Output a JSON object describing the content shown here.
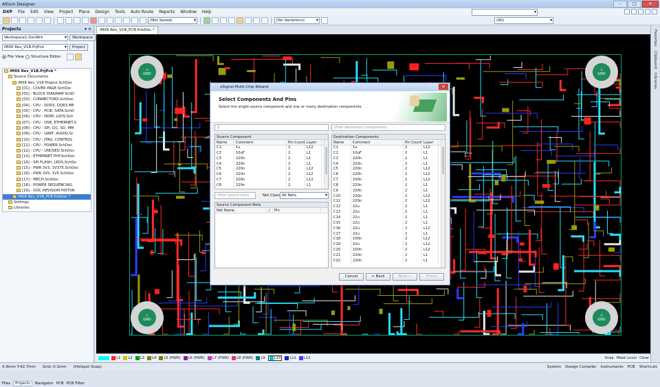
{
  "app": {
    "title": "Altium Designer",
    "dxp": "DXP"
  },
  "menu": [
    "File",
    "Edit",
    "View",
    "Project",
    "Place",
    "Design",
    "Tools",
    "Auto Route",
    "Reports",
    "Window",
    "Help"
  ],
  "toolbar": {
    "saved_combo": "(Not Saved)",
    "variations_combo": "[No Variations]",
    "filter_combo": "(All)"
  },
  "projects_panel": {
    "title": "Projects",
    "workspace_value": "Workspace1.DsnWrk",
    "workspace_button": "Workspace",
    "project_value": "iMX6 Rev_V1B.PrjPcb",
    "project_button": "Project",
    "file_view": "File View",
    "structure_editor": "Structure Editor",
    "tree": [
      {
        "label": "iMX6 Rev_V1B.PrjPcb *",
        "indent": 0,
        "bold": true
      },
      {
        "label": "Source Documents",
        "indent": 1
      },
      {
        "label": "iMX6 Rev_V1B Project.SchDoc",
        "indent": 2
      },
      {
        "label": "[01] - COVER PAGE.SchDoc",
        "indent": 3
      },
      {
        "label": "[02] - BLOCK DIAGRAM.SchD",
        "indent": 3
      },
      {
        "label": "[03] - CONNECTORS.SchDoc",
        "indent": 3
      },
      {
        "label": "[04] - CPU - DDR3, DDR3 ME",
        "indent": 3
      },
      {
        "label": "[05] - CPU - PCIE, SATA.SchD",
        "indent": 3
      },
      {
        "label": "[06] - CPU - HDMI, LVDS.Sch",
        "indent": 3
      },
      {
        "label": "[07] - CPU - USB, ETHERNET.S",
        "indent": 3
      },
      {
        "label": "[08] - CPU - SPI, I2C, SD, MM",
        "indent": 3
      },
      {
        "label": "[09] - CPU - UART, AUDIO.Sc",
        "indent": 3
      },
      {
        "label": "[10] - CPU - JTAG, CONTROL",
        "indent": 3
      },
      {
        "label": "[11] - CPU - POWER.SchDoc",
        "indent": 3
      },
      {
        "label": "[12] - CPU - UNUSED.SchDoc",
        "indent": 3
      },
      {
        "label": "[13] - ETHERNET PHY.SchDoc",
        "indent": 3
      },
      {
        "label": "[14] - SPI FLASH, LEDS.SchDo",
        "indent": 3
      },
      {
        "label": "[15] - PWR 3V3, 1V375.SchDoc",
        "indent": 3
      },
      {
        "label": "[16] - PWR 2V5, 1V5.SchDoc",
        "indent": 3
      },
      {
        "label": "[17] - MECH.SchDoc",
        "indent": 3
      },
      {
        "label": "[18] - POWER SEQUENCING.",
        "indent": 3
      },
      {
        "label": "[19] - DOC REVISION HISTOR",
        "indent": 3
      },
      {
        "label": "iMX6 Rev_V1B_PCB.PcbDoc *",
        "indent": 2,
        "selected": true
      },
      {
        "label": "Settings",
        "indent": 1
      },
      {
        "label": "Libraries",
        "indent": 1
      }
    ],
    "tabs": [
      "Files",
      "Projects",
      "Navigator",
      "PCB",
      "PCB Filter"
    ]
  },
  "document_tab": "iMX6 Rev_V1B_PCB.PcbDoc *",
  "right_panels": [
    "Favorites",
    "Clipboard",
    "Libraries"
  ],
  "board": {
    "hole_label_top": "GND",
    "hole_label": "GND"
  },
  "wizard": {
    "title": "xSignal Multi-Chip Wizard",
    "heading": "Select Components And Pins",
    "subheading": "Select the single source component and one or many destination components",
    "filter_dest_placeholder": "(filter destination components)",
    "filter_nets_placeholder": "(filter source nets)",
    "net_class_label": "Net Class:",
    "net_class_value": "All Nets",
    "source": {
      "caption": "Source Component",
      "headers": [
        "Name",
        "Comment",
        "Pin Count",
        "Layer"
      ],
      "rows": [
        [
          "C1",
          "1u",
          "2",
          "L12"
        ],
        [
          "C2",
          "10uF",
          "2",
          "L1"
        ],
        [
          "C3",
          "220n",
          "2",
          "L1"
        ],
        [
          "C4",
          "220n",
          "2",
          "L1"
        ],
        [
          "C5",
          "220n",
          "2",
          "L12"
        ],
        [
          "C6",
          "220n",
          "2",
          "L12"
        ],
        [
          "C7",
          "100n",
          "2",
          "L12"
        ],
        [
          "C8",
          "220n",
          "2",
          "L1"
        ]
      ]
    },
    "nets": {
      "caption": "Source Component Nets",
      "headers": [
        "Net Name",
        "/",
        "Pin"
      ]
    },
    "dest": {
      "caption": "Destination Components",
      "headers": [
        "Name",
        "Comment",
        "Pin Count",
        "Layer"
      ],
      "rows": [
        [
          "C1",
          "1u",
          "2",
          "L12"
        ],
        [
          "C2",
          "10uF",
          "2",
          "L1"
        ],
        [
          "C3",
          "220n",
          "2",
          "L1"
        ],
        [
          "C4",
          "220n",
          "2",
          "L1"
        ],
        [
          "C5",
          "220n",
          "2",
          "L12"
        ],
        [
          "C6",
          "220n",
          "2",
          "L12"
        ],
        [
          "C7",
          "100n",
          "2",
          "L12"
        ],
        [
          "C8",
          "220n",
          "2",
          "L1"
        ],
        [
          "C9",
          "220n",
          "2",
          "L1"
        ],
        [
          "C10",
          "220n",
          "2",
          "L12"
        ],
        [
          "C11",
          "220n",
          "2",
          "L12"
        ],
        [
          "C12",
          "22u",
          "2",
          "L1"
        ],
        [
          "C13",
          "22u",
          "2",
          "L1"
        ],
        [
          "C14",
          "22u",
          "2",
          "L1"
        ],
        [
          "C15",
          "22u",
          "2",
          "L1"
        ],
        [
          "C16",
          "22u",
          "2",
          "L12"
        ],
        [
          "C17",
          "22u",
          "2",
          "L1"
        ],
        [
          "C18",
          "100n",
          "2",
          "L12"
        ],
        [
          "C19",
          "10u",
          "2",
          "L12"
        ],
        [
          "C20",
          "100n",
          "2",
          "L12"
        ],
        [
          "C21",
          "220n",
          "2",
          "L1"
        ],
        [
          "C22",
          "220n",
          "2",
          "L1"
        ]
      ]
    },
    "buttons": {
      "cancel": "Cancel",
      "back": "< Back",
      "next": "Next >",
      "finish": "Finish"
    }
  },
  "layers": [
    {
      "label": "L1",
      "color": "#ff2020"
    },
    {
      "label": "L2",
      "color": "#c8c800"
    },
    {
      "label": "L3",
      "color": "#00a000"
    },
    {
      "label": "L4",
      "color": "#808000"
    },
    {
      "label": "L5 (PWR)",
      "color": "#808000"
    },
    {
      "label": "L6 (PWR)",
      "color": "#8020a0"
    },
    {
      "label": "L7 (PWR)",
      "color": "#c040c0"
    },
    {
      "label": "L8 (PWR)",
      "color": "#d04070"
    },
    {
      "label": "L9",
      "color": "#008080"
    },
    {
      "label": "L10",
      "color": "#00c8c8",
      "active": true
    },
    {
      "label": "L11",
      "color": "#2020c0"
    },
    {
      "label": "L12",
      "color": "#4040ff"
    }
  ],
  "layerbar_right": [
    "Snap",
    "Mask Level",
    "Clear"
  ],
  "status": {
    "coords": "X:9mm Y:42.7mm",
    "grid": "Grid: 0.1mm",
    "snap": "(Hotspot Snap)",
    "right": [
      "System",
      "Design Compiler",
      "Instruments",
      "PCB",
      "Shortcuts"
    ]
  }
}
